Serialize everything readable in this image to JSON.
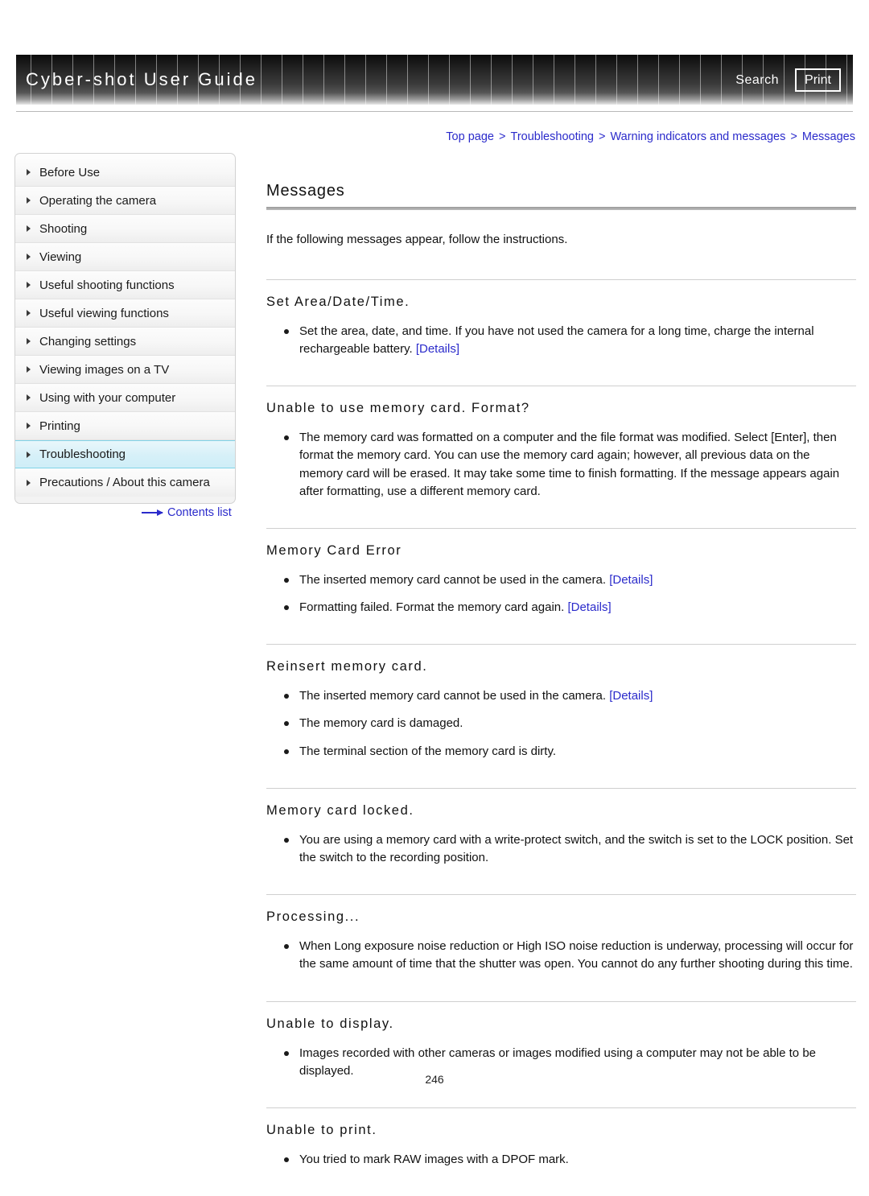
{
  "header": {
    "title": "Cyber-shot User Guide",
    "search_label": "Search",
    "print_label": "Print"
  },
  "breadcrumb": {
    "items": [
      "Top page",
      "Troubleshooting",
      "Warning indicators and messages",
      "Messages"
    ],
    "separator": ">"
  },
  "sidebar": {
    "items": [
      {
        "label": "Before Use",
        "active": false
      },
      {
        "label": "Operating the camera",
        "active": false
      },
      {
        "label": "Shooting",
        "active": false
      },
      {
        "label": "Viewing",
        "active": false
      },
      {
        "label": "Useful shooting functions",
        "active": false
      },
      {
        "label": "Useful viewing functions",
        "active": false
      },
      {
        "label": "Changing settings",
        "active": false
      },
      {
        "label": "Viewing images on a TV",
        "active": false
      },
      {
        "label": "Using with your computer",
        "active": false
      },
      {
        "label": "Printing",
        "active": false
      },
      {
        "label": "Troubleshooting",
        "active": true
      },
      {
        "label": "Precautions / About this camera",
        "active": false
      }
    ],
    "contents_link": "Contents list"
  },
  "main": {
    "title": "Messages",
    "intro": "If the following messages appear, follow the instructions.",
    "sections": [
      {
        "heading": "Set Area/Date/Time.",
        "bullets": [
          {
            "text": "Set the area, date, and time. If you have not used the camera for a long time, charge the internal rechargeable battery.",
            "link": "[Details]"
          }
        ]
      },
      {
        "heading": "Unable to use memory card. Format?",
        "bullets": [
          {
            "text": "The memory card was formatted on a computer and the file format was modified. Select [Enter], then format the memory card. You can use the memory card again; however, all previous data on the memory card will be erased. It may take some time to finish formatting. If the message appears again after formatting, use a different memory card.",
            "link": ""
          }
        ]
      },
      {
        "heading": "Memory Card Error",
        "bullets": [
          {
            "text": "The inserted memory card cannot be used in the camera.",
            "link": "[Details]"
          },
          {
            "text": "Formatting failed. Format the memory card again.",
            "link": "[Details]"
          }
        ]
      },
      {
        "heading": "Reinsert memory card.",
        "bullets": [
          {
            "text": "The inserted memory card cannot be used in the camera.",
            "link": "[Details]"
          },
          {
            "text": "The memory card is damaged.",
            "link": ""
          },
          {
            "text": "The terminal section of the memory card is dirty.",
            "link": ""
          }
        ]
      },
      {
        "heading": "Memory card locked.",
        "bullets": [
          {
            "text": "You are using a memory card with a write-protect switch, and the switch is set to the LOCK position. Set the switch to the recording position.",
            "link": ""
          }
        ]
      },
      {
        "heading": "Processing...",
        "bullets": [
          {
            "text": "When Long exposure noise reduction or High ISO noise reduction is underway, processing will occur for the same amount of time that the shutter was open. You cannot do any further shooting during this time.",
            "link": ""
          }
        ]
      },
      {
        "heading": "Unable to display.",
        "bullets": [
          {
            "text": "Images recorded with other cameras or images modified using a computer may not be able to be displayed.",
            "link": ""
          }
        ]
      },
      {
        "heading": "Unable to print.",
        "bullets": [
          {
            "text": "You tried to mark RAW images with a DPOF mark.",
            "link": ""
          }
        ]
      }
    ]
  },
  "footer": {
    "page_number": "246"
  },
  "colors": {
    "link": "#2b2bcb",
    "active_sidebar_bg": "#d6f0f8",
    "active_sidebar_border": "#7fd3e8",
    "banner_dark": "#141414"
  }
}
